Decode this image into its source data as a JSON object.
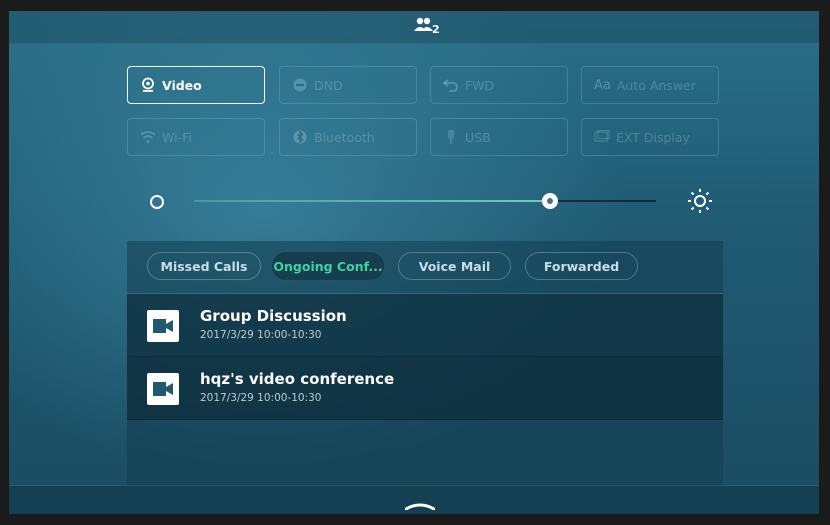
{
  "status_bar": {
    "contacts_count": "2"
  },
  "quick_buttons": [
    {
      "label": "Video",
      "icon": "camera-icon",
      "active": true
    },
    {
      "label": "DND",
      "icon": "dnd-icon",
      "active": false
    },
    {
      "label": "FWD",
      "icon": "forward-icon",
      "active": false
    },
    {
      "label": "Auto Answer",
      "icon": "auto-answer-icon",
      "active": false
    },
    {
      "label": "Wi-Fi",
      "icon": "wifi-icon",
      "active": false
    },
    {
      "label": "Bluetooth",
      "icon": "bluetooth-icon",
      "active": false
    },
    {
      "label": "USB",
      "icon": "usb-icon",
      "active": false
    },
    {
      "label": "EXT Display",
      "icon": "display-icon",
      "active": false
    }
  ],
  "brightness": {
    "level_percent": 80
  },
  "tabs": [
    {
      "label": "Missed Calls",
      "active": false
    },
    {
      "label": "Ongoing Conf...",
      "active": true
    },
    {
      "label": "Voice Mail",
      "active": false
    },
    {
      "label": "Forwarded",
      "active": false
    }
  ],
  "conferences": [
    {
      "title": "Group Discussion",
      "time": "2017/3/29 10:00-10:30"
    },
    {
      "title": "hqz's video conference",
      "time": "2017/3/29 10:00-10:30"
    }
  ],
  "colors": {
    "accent_green": "#3fd2a0",
    "background": "#2a6f88"
  }
}
